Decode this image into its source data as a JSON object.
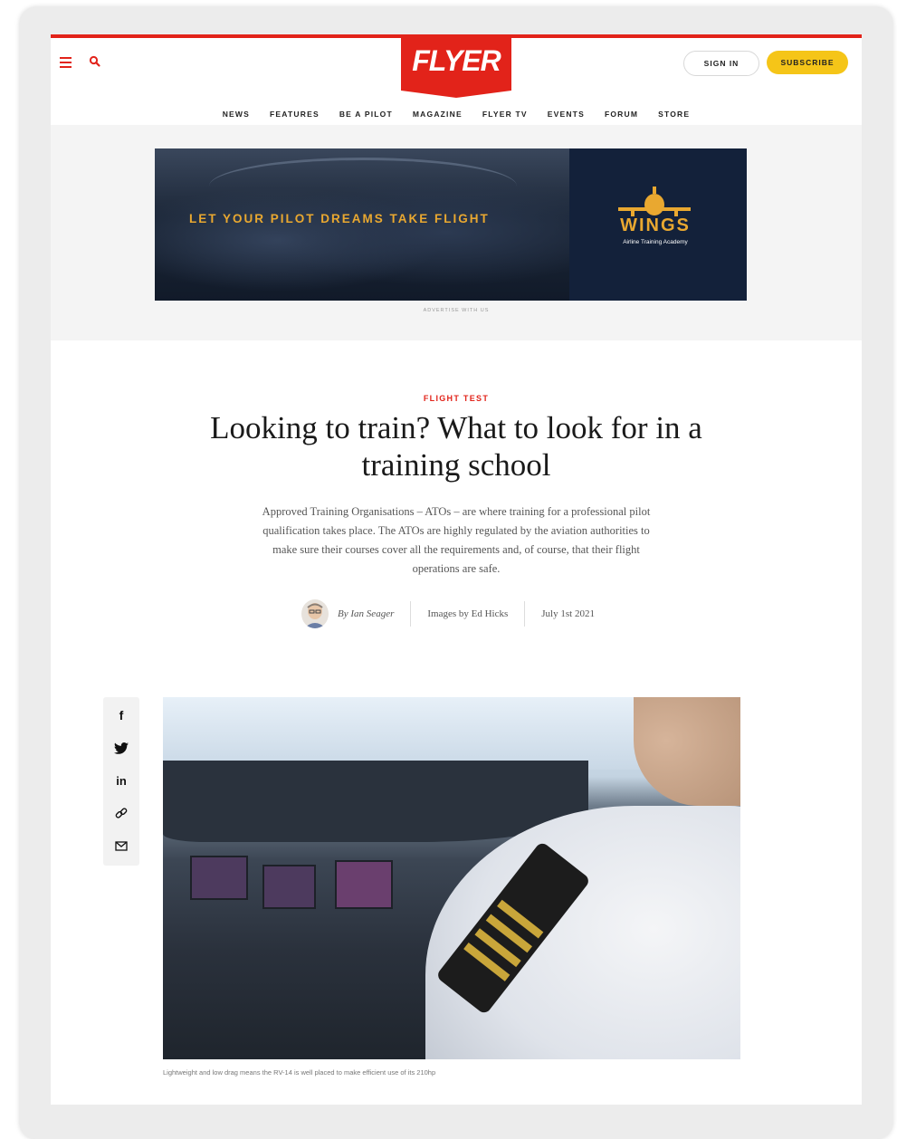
{
  "header": {
    "logo_text": "FLYER",
    "sign_in_label": "SIGN IN",
    "subscribe_label": "SUBSCRIBE"
  },
  "nav": {
    "items": [
      "NEWS",
      "FEATURES",
      "BE A PILOT",
      "MAGAZINE",
      "FLYER TV",
      "EVENTS",
      "FORUM",
      "STORE"
    ]
  },
  "ad": {
    "headline": "LET YOUR PILOT DREAMS TAKE FLIGHT",
    "brand_name": "WINGS",
    "brand_tagline": "Airline Training Academy",
    "advertise_link": "ADVERTISE WITH US"
  },
  "article": {
    "category": "FLIGHT TEST",
    "title": "Looking to train? What to look for in a training school",
    "standfirst": "Approved Training Organisations – ATOs – are where training for a professional pilot qualification takes place. The ATOs are highly regulated by the aviation authorities to make sure their courses cover all the requirements and, of course, that their flight operations are safe.",
    "author": "By Ian Seager",
    "images_credit": "Images by Ed Hicks",
    "date": "July 1st 2021",
    "image_caption": "Lightweight and low drag means the RV-14 is well placed to make efficient use of its 210hp"
  },
  "share": {
    "facebook_glyph": "f",
    "linkedin_glyph": "in"
  },
  "colors": {
    "brand_red": "#e2231a",
    "subscribe_yellow": "#f5c518",
    "ad_gold": "#e9a830"
  }
}
